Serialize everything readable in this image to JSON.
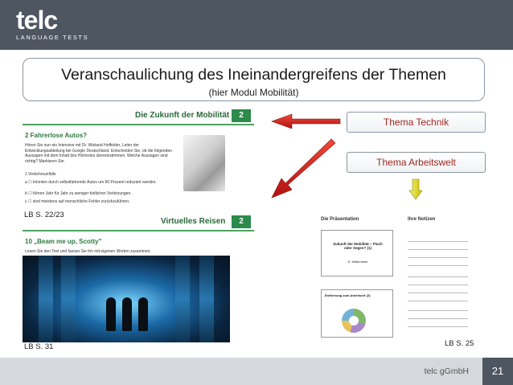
{
  "logo": {
    "main": "telc",
    "sub": "LANGUAGE TESTS"
  },
  "title": {
    "main": "Veranschaulichung des Ineinandergreifens der Themen",
    "sub": "(hier Modul Mobilität)"
  },
  "left_page": {
    "chapter1": {
      "title": "Die Zukunft der Mobilität",
      "number": "2"
    },
    "exercise1": {
      "title": "2 Fahrerlose Autos?",
      "text": "Hören Sie nun ein Interview mit Dr. Wieland Hoffelder, Leiter der Entwicklungsabteilung bei Google Deutschland. Entscheiden Sie, ob die folgenden Aussagen mit dem Inhalt des Hörtextes übereinstimmen. Welche Aussagen sind richtig? Markieren Sie.",
      "items": [
        "1  Verkehrsunfälle",
        "a  ☐  könnten durch selbstfahrende Autos um 90 Prozent reduziert werden.",
        "b  ☐  führen Jahr für Jahr zu weniger tödlichen Verletzungen.",
        "c  ☐  sind meistens auf menschliche Fehler zurückzuführen."
      ]
    },
    "chapter2": {
      "title": "Virtuelles Reisen",
      "number": "2"
    },
    "exercise2": {
      "title": "10 „Beam me up, Scotty\"",
      "text": "Lesen Sie den Text und fassen Sie ihn mit eigenen Worten zusammen."
    },
    "label_top": "LB S. 22/23",
    "label_bottom": "LB S. 31"
  },
  "arrow_boxes": {
    "technik": "Thema Technik",
    "arbeitswelt": "Thema Arbeitswelt"
  },
  "right_page": {
    "head_left": "Die Präsentation",
    "head_right": "Ihre Notizen",
    "box1_title": "Zukunft der Mobilität – Fluch oder Segen? (1)",
    "box1_sub": "S. Mittermeier",
    "box2_title": "Entfernung zum Arbeitsort (2)",
    "label": "LB S. 25"
  },
  "footer": {
    "company": "telc gGmbH",
    "page": "21"
  },
  "colors": {
    "header": "#4d5661",
    "footer": "#d5d8dc",
    "box_text": "#a0281f",
    "red_arrow": "#d42020",
    "yellow_arrow": "#e8e020",
    "chapter_green": "#2c8a4a"
  }
}
